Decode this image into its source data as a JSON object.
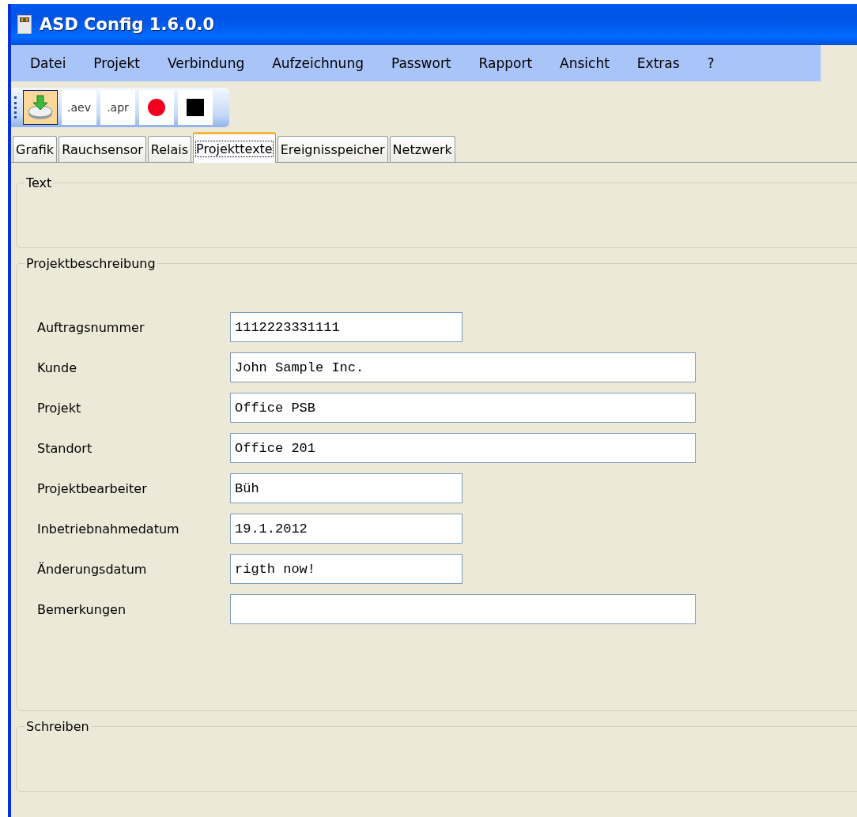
{
  "window": {
    "title": "ASD Config 1.6.0.0"
  },
  "menu": [
    "Datei",
    "Projekt",
    "Verbindung",
    "Aufzeichnung",
    "Passwort",
    "Rapport",
    "Ansicht",
    "Extras",
    "?"
  ],
  "toolbar": [
    {
      "kind": "download",
      "pressed": true
    },
    {
      "kind": "text",
      "label": ".aev",
      "pressed": false
    },
    {
      "kind": "text",
      "label": ".apr",
      "pressed": false
    },
    {
      "kind": "record",
      "pressed": false
    },
    {
      "kind": "stop",
      "pressed": false
    }
  ],
  "tabs": [
    {
      "label": "Grafik",
      "selected": false
    },
    {
      "label": "Rauchsensor",
      "selected": false
    },
    {
      "label": "Relais",
      "selected": false
    },
    {
      "label": "Projekttexte",
      "selected": true
    },
    {
      "label": "Ereignisspeicher",
      "selected": false
    },
    {
      "label": "Netzwerk",
      "selected": false
    }
  ],
  "groups": [
    {
      "title": "Text",
      "kind": "empty"
    },
    {
      "title": "Projektbeschreibung",
      "kind": "form",
      "fields": [
        {
          "label": "Auftragsnummer",
          "value": "1112223331111",
          "kind": "short"
        },
        {
          "label": "Kunde",
          "value": "John Sample Inc.",
          "kind": "long"
        },
        {
          "label": "Projekt",
          "value": "Office PSB",
          "kind": "long"
        },
        {
          "label": "Standort",
          "value": "Office 201",
          "kind": "long"
        },
        {
          "label": "Projektbearbeiter",
          "value": "Büh",
          "kind": "short"
        },
        {
          "label": "Inbetriebnahmedatum",
          "value": "19.1.2012",
          "kind": "short"
        },
        {
          "label": "Änderungsdatum",
          "value": "rigth now!",
          "kind": "short"
        },
        {
          "label": "Bemerkungen",
          "kind": "long"
        }
      ]
    },
    {
      "title": "Schreiben",
      "kind": "empty"
    }
  ]
}
